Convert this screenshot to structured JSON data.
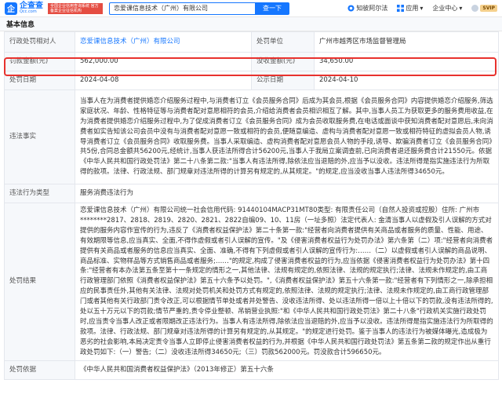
{
  "header": {
    "logo_mark": "企",
    "logo_name": "企查查",
    "logo_domain": "Qcc.com",
    "badge": "全国企业信用查询系统 官方备案企业征信机构",
    "search_value": "恋爱课信息技术（广州）有限公司",
    "search_button": "查一下",
    "nav": {
      "zhipo": "知彼阿尔法",
      "app": "应用",
      "enterprise": "企业中心",
      "vip_badge": "SVIP"
    }
  },
  "section_title": "基本信息",
  "rows": {
    "org_label": "行政处罚相对人",
    "org_value": "恋爱课信息技术（广州）有限公司",
    "unit_label": "处罚单位",
    "unit_value": "广州市越秀区市场监督管理局",
    "fine_label": "罚款金额(元)",
    "fine_value": "562,000.00",
    "confiscate_label": "没收金额(元)",
    "confiscate_value": "34,650.00",
    "date_label": "处罚日期",
    "date_value": "2024-04-08",
    "pub_label": "公示日期",
    "pub_value": "2024-04-10",
    "facts_label": "违法事实",
    "facts_value": "当事人在为消费者提供婚恋介绍服务过程中,与消费者订立《会员服务合同》后成为其会员,根据《会员服务合同》内容提供婚恋介绍服务,筛选家庭状况、年龄、性格特征等与消费者配对意愿相符的会员,介绍给消费者会员相识相互了解。其中,当事人员工为获取更多的服务费用收益,在为消费者提供婚恋介绍服务过程中,为了促成消费者订立《会员服务合同》成为会员收取服务费,在电话或面谈中获知消费者配对意愿后,未向消费者如实告知该公司会员中没有与消费者配对意愿一致或相符的会员,便随意编造、虚构与消费者配对意愿一致或相符特征的虚拟会员人物,诱导消费者订立《会员服务合同》收取服务费。当事人采取编造、虚构消费者配对意愿会员人物的手段,诱导、欺骗消费者订立《会员服务合同》共5份,合同总金额共56200元,经统计,当事人获违法所得合计56200元,当事人于我局立案调查前,已向消费者退还服务费合计21550元。依据《中华人民共和国行政处罚法》第二十八条第二款:\"当事人有违法所得,除依法应当退赔的外,应当予以没收。违法所得是指实施违法行为所取得的款项。法律、行政法规、部门规章对违法所得的计算另有规定的,从其规定。\"的规定,应当没收当事人违法所得34650元。",
    "type_label": "违法行为类型",
    "type_value": "服务消费违法行为",
    "result_label": "处罚结果",
    "result_value": "恋爱课信息技术（广州）有限公司统一社会信用代码: 91440104MACP31MT80类型: 有限责任公司（自然人投资或控股）住所: 广州市********2817、2818、2819、2820、2821、2822自编09、10、11房（一址多照）法定代表人: 金清当事人以虚假及引人误解的方式对提供的服务内容作宣传的行为,违反了《消费者权益保护法》第二十条第一款:\"经营者向消费者提供有关商品或者服务的质量、性能、用途、有效期限等信息,应当真实、全面,不得作虚假或者引人误解的宣传。\"及《侵害消费者权益行为处罚办法》第六条第（二）项:\"经营者向消费者提供有关商品或者服务的信息应当真实、全面、准确,不得有下列虚假或者引人误解的宣传行为:……（二）以虚假或者引人误解的商品说明、商品标准、实物样品等方式销售商品或者服务;……\"的规定,构成了侵害消费者权益的行为,应当依据《侵害消费者权益行为处罚办法》第十四条:\"经营者有本办法第五条至第十一条规定的情形之一,其他法律、法规有规定的,依照法律、法规的规定执行;法律、法规未作规定的,由工商行政管理部门依照《消费者权益保护法》第五十六条予以处罚。\",《消费者权益保护法》第五十六条第一款:\"经营者有下列情形之一,除承担相应的民事责任外,其他有关法律、法规对处罚机关和处罚方式有规定的,依照法律、法规的规定执行;法律、法规未作规定的,由工商行政管理部门或者其他有关行政部门责令改正,可以根据情节单处或者并处警告、没收违法所得、处以违法所得一倍以上十倍以下的罚款,没有违法所得的,处以五十万元以下的罚款;情节严重的,责令停业整顿、吊销营业执照:\"和《中华人民共和国行政处罚法》第二十八条\"行政机关实施行政处罚时,应当责令当事人改正或者限期改正违法行为。当事人有违法所得,除依法应当退赔的外,应当予以没收。违法所得是指实施违法行为所取得的款项。法律、行政法规、部门规章对违法所得的计算另有规定的,从其规定。\"的规定进行处罚。鉴于当事人的违法行为被媒体曝光,造成极为恶劣的社会影响,本局决定责令当事人立即停止侵害消费者权益的行为,并根据《中华人民共和国行政处罚法》第五条第二款的规定作出从重行政处罚如下:（一）警告;（二）没收违法所得34650元;（三）罚款562000元。罚没款合计596650元。",
    "basis_label": "处罚依据",
    "basis_value": "《中华人民共和国消费者权益保护法》（2013年修正）第五十六条"
  }
}
